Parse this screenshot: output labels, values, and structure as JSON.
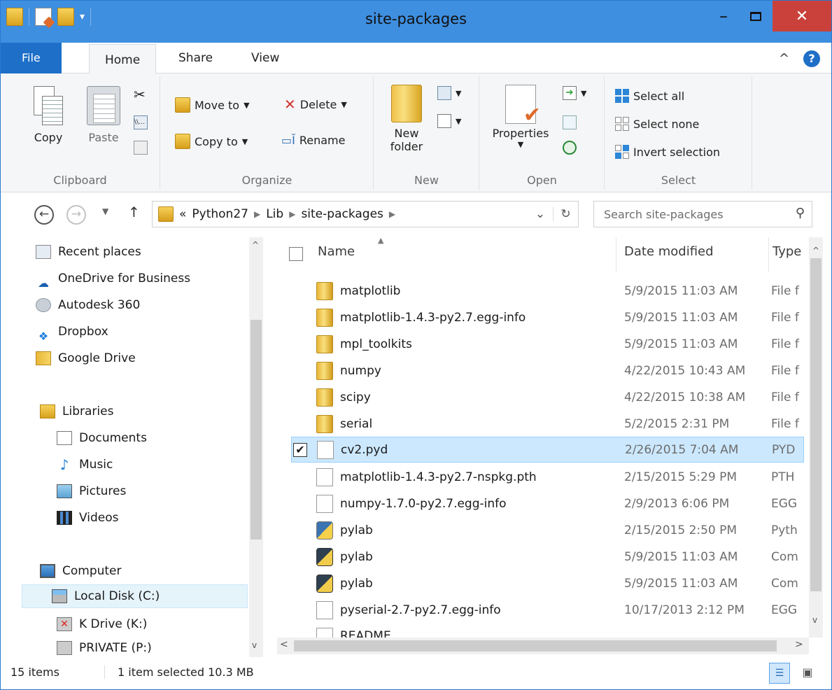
{
  "window": {
    "title": "site-packages"
  },
  "controls": {
    "minimize": "–",
    "close": "✕"
  },
  "tabs": {
    "file": "File",
    "home": "Home",
    "share": "Share",
    "view": "View"
  },
  "ribbon": {
    "clipboard": {
      "copy": "Copy",
      "paste": "Paste",
      "label": "Clipboard"
    },
    "organize": {
      "move_to": "Move to",
      "copy_to": "Copy to",
      "delete": "Delete",
      "rename": "Rename",
      "label": "Organize"
    },
    "new": {
      "new_folder_1": "New",
      "new_folder_2": "folder",
      "label": "New"
    },
    "open": {
      "properties": "Properties",
      "label": "Open"
    },
    "select": {
      "select_all": "Select all",
      "select_none": "Select none",
      "invert": "Invert selection",
      "label": "Select"
    }
  },
  "address": {
    "prefix": "«",
    "crumbs": [
      "Python27",
      "Lib",
      "site-packages"
    ],
    "search_placeholder": "Search site-packages"
  },
  "nav": {
    "favorites": [
      "Recent places",
      "OneDrive for Business",
      "Autodesk 360",
      "Dropbox",
      "Google Drive"
    ],
    "libraries": "Libraries",
    "library_items": [
      "Documents",
      "Music",
      "Pictures",
      "Videos"
    ],
    "computer": "Computer",
    "computer_items": [
      "Local Disk (C:)",
      "K Drive (K:)",
      "PRIVATE (P:)"
    ]
  },
  "columns": {
    "name": "Name",
    "date": "Date modified",
    "type": "Type"
  },
  "files": [
    {
      "name": "matplotlib",
      "date": "5/9/2015 11:03 AM",
      "type": "File f",
      "icon": "folder-icon"
    },
    {
      "name": "matplotlib-1.4.3-py2.7.egg-info",
      "date": "5/9/2015 11:03 AM",
      "type": "File f",
      "icon": "folder-icon"
    },
    {
      "name": "mpl_toolkits",
      "date": "5/9/2015 11:03 AM",
      "type": "File f",
      "icon": "folder-icon"
    },
    {
      "name": "numpy",
      "date": "4/22/2015 10:43 AM",
      "type": "File f",
      "icon": "folder-icon"
    },
    {
      "name": "scipy",
      "date": "4/22/2015 10:38 AM",
      "type": "File f",
      "icon": "folder-icon"
    },
    {
      "name": "serial",
      "date": "5/2/2015 2:31 PM",
      "type": "File f",
      "icon": "folder-icon"
    },
    {
      "name": "cv2.pyd",
      "date": "2/26/2015 7:04 AM",
      "type": "PYD",
      "icon": "file-icon"
    },
    {
      "name": "matplotlib-1.4.3-py2.7-nspkg.pth",
      "date": "2/15/2015 5:29 PM",
      "type": "PTH",
      "icon": "file-icon"
    },
    {
      "name": "numpy-1.7.0-py2.7.egg-info",
      "date": "2/9/2013 6:06 PM",
      "type": "EGG",
      "icon": "file-icon"
    },
    {
      "name": "pylab",
      "date": "2/15/2015 2:50 PM",
      "type": "Pyth",
      "icon": "python-file-icon"
    },
    {
      "name": "pylab",
      "date": "5/9/2015 11:03 AM",
      "type": "Com",
      "icon": "python-compiled-icon"
    },
    {
      "name": "pylab",
      "date": "5/9/2015 11:03 AM",
      "type": "Com",
      "icon": "python-compiled-icon"
    },
    {
      "name": "pyserial-2.7-py2.7.egg-info",
      "date": "10/17/2013 2:12 PM",
      "type": "EGG",
      "icon": "file-icon"
    },
    {
      "name": "README",
      "date": "",
      "type": "",
      "icon": "text-file-icon"
    }
  ],
  "status": {
    "count": "15 items",
    "selection": "1 item selected  10.3 MB"
  },
  "colors": {
    "titlebar": "#3f8fe0",
    "close": "#c9413a",
    "file_tab": "#1e6fc8",
    "selection": "#cce8ff"
  }
}
